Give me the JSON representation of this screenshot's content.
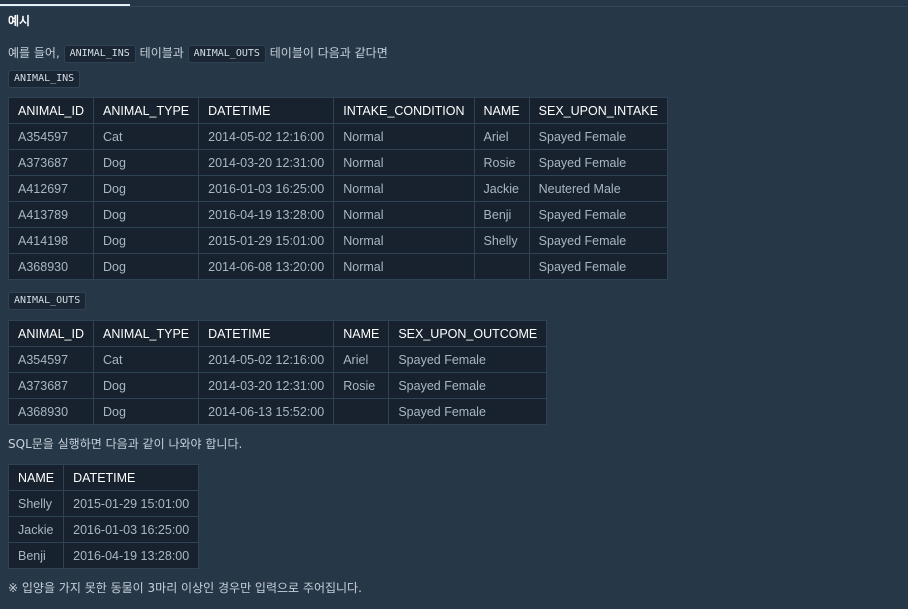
{
  "section_title": "예시",
  "intro": {
    "prefix": "예를 들어,",
    "table_a_code": "ANIMAL_INS",
    "middle": "테이블과",
    "table_b_code": "ANIMAL_OUTS",
    "suffix": "테이블이 다음과 같다면"
  },
  "animal_ins": {
    "label": "ANIMAL_INS",
    "columns": [
      "ANIMAL_ID",
      "ANIMAL_TYPE",
      "DATETIME",
      "INTAKE_CONDITION",
      "NAME",
      "SEX_UPON_INTAKE"
    ],
    "rows": [
      [
        "A354597",
        "Cat",
        "2014-05-02 12:16:00",
        "Normal",
        "Ariel",
        "Spayed Female"
      ],
      [
        "A373687",
        "Dog",
        "2014-03-20 12:31:00",
        "Normal",
        "Rosie",
        "Spayed Female"
      ],
      [
        "A412697",
        "Dog",
        "2016-01-03 16:25:00",
        "Normal",
        "Jackie",
        "Neutered Male"
      ],
      [
        "A413789",
        "Dog",
        "2016-04-19 13:28:00",
        "Normal",
        "Benji",
        "Spayed Female"
      ],
      [
        "A414198",
        "Dog",
        "2015-01-29 15:01:00",
        "Normal",
        "Shelly",
        "Spayed Female"
      ],
      [
        "A368930",
        "Dog",
        "2014-06-08 13:20:00",
        "Normal",
        "",
        "Spayed Female"
      ]
    ]
  },
  "animal_outs": {
    "label": "ANIMAL_OUTS",
    "columns": [
      "ANIMAL_ID",
      "ANIMAL_TYPE",
      "DATETIME",
      "NAME",
      "SEX_UPON_OUTCOME"
    ],
    "rows": [
      [
        "A354597",
        "Cat",
        "2014-05-02 12:16:00",
        "Ariel",
        "Spayed Female"
      ],
      [
        "A373687",
        "Dog",
        "2014-03-20 12:31:00",
        "Rosie",
        "Spayed Female"
      ],
      [
        "A368930",
        "Dog",
        "2014-06-13 15:52:00",
        "",
        "Spayed Female"
      ]
    ]
  },
  "result_intro": "SQL문을 실행하면 다음과 같이 나와야 합니다.",
  "result": {
    "columns": [
      "NAME",
      "DATETIME"
    ],
    "rows": [
      [
        "Shelly",
        "2015-01-29 15:01:00"
      ],
      [
        "Jackie",
        "2016-01-03 16:25:00"
      ],
      [
        "Benji",
        "2016-04-19 13:28:00"
      ]
    ]
  },
  "note": "※ 입양을 가지 못한 동물이 3마리 이상인 경우만 입력으로 주어집니다.",
  "colors": {
    "background": "#263747",
    "table_background": "#17222e",
    "border": "#2f4355",
    "header_text": "#ffffff",
    "cell_text": "#a9b7c4"
  }
}
